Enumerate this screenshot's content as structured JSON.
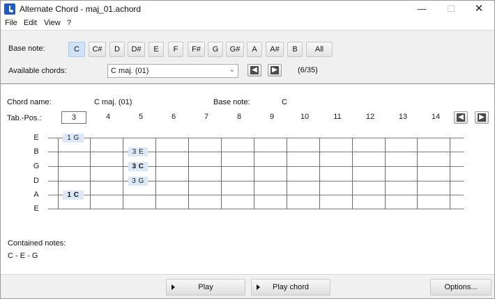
{
  "window": {
    "title": "Alternate Chord - maj_01.achord",
    "minimize": "—",
    "maximize": "☐",
    "close": "✕"
  },
  "menu": [
    "File",
    "Edit",
    "View",
    "?"
  ],
  "base_note_label": "Base note:",
  "base_notes": [
    "C",
    "C#",
    "D",
    "D#",
    "E",
    "F",
    "F#",
    "G",
    "G#",
    "A",
    "A#",
    "B",
    "All"
  ],
  "selected_base_note": "C",
  "available_chords_label": "Available chords:",
  "available_chords_value": "C maj. (01)",
  "chord_count": "(6/35)",
  "chord_info": {
    "chord_name_label": "Chord name:",
    "chord_name_value": "C maj. (01)",
    "base_note_label": "Base note:",
    "base_note_value": "C"
  },
  "tab_pos": {
    "label": "Tab.-Pos.:",
    "value": "3",
    "positions": [
      "4",
      "5",
      "6",
      "7",
      "8",
      "9",
      "10",
      "11",
      "12",
      "13",
      "14"
    ]
  },
  "strings": [
    "E",
    "B",
    "G",
    "D",
    "A",
    "E"
  ],
  "fret_markers": [
    {
      "string": 0,
      "fret": 0,
      "text": "1 G",
      "bold": false
    },
    {
      "string": 1,
      "fret": 2,
      "text": "3 E",
      "bold": false
    },
    {
      "string": 2,
      "fret": 2,
      "text": "3 C",
      "bold": true
    },
    {
      "string": 3,
      "fret": 2,
      "text": "3 G",
      "bold": false
    },
    {
      "string": 4,
      "fret": 0,
      "text": "1 C",
      "bold": true
    }
  ],
  "contained_notes_label": "Contained notes:",
  "contained_notes_value": "C - E - G",
  "buttons": {
    "play": "Play",
    "play_chord": "Play chord",
    "options": "Options..."
  },
  "colors": {
    "panel": "#f0f0f0",
    "active_note": "#cfe2f6",
    "marker": "#dbe8f7"
  },
  "icons": {
    "prev": "arrow-left-icon",
    "next": "arrow-right-icon"
  }
}
